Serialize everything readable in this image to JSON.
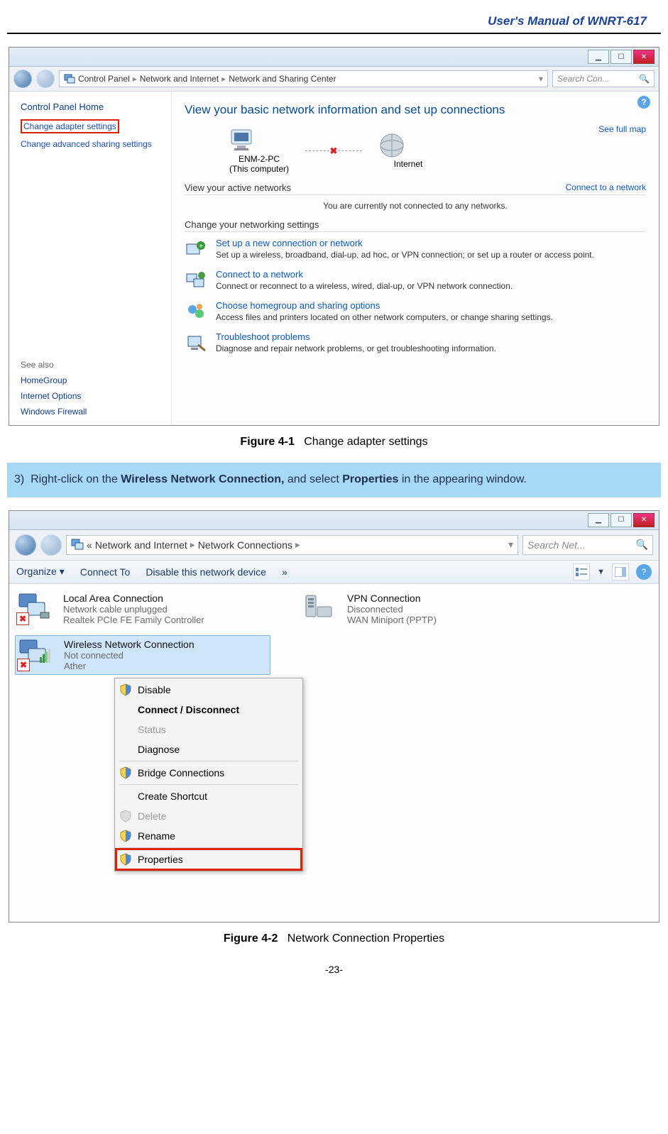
{
  "doc": {
    "header": "User's Manual of WNRT-617",
    "page_number": "-23-"
  },
  "fig1": {
    "label_bold": "Figure 4-1",
    "label_rest": "Change adapter settings"
  },
  "fig2": {
    "label_bold": "Figure 4-2",
    "label_rest": "Network Connection Properties"
  },
  "step": {
    "num": "3)",
    "t1": "Right-click on the ",
    "b1": "Wireless Network Connection,",
    "t2": " and select ",
    "b2": "Properties",
    "t3": " in the appearing window."
  },
  "s1": {
    "breadcrumb": [
      "Control Panel",
      "Network and Internet",
      "Network and Sharing Center"
    ],
    "search_placeholder": "Search Con...",
    "sidebar": {
      "head": "Control Panel Home",
      "items": [
        "Change adapter settings",
        "Change advanced sharing settings"
      ],
      "see_also_head": "See also",
      "see_also": [
        "HomeGroup",
        "Internet Options",
        "Windows Firewall"
      ]
    },
    "main": {
      "title": "View your basic network information and set up connections",
      "full_map": "See full map",
      "comp_name": "ENM-2-PC",
      "comp_sub": "(This computer)",
      "internet": "Internet",
      "active_label": "View your active networks",
      "connect_link": "Connect to a network",
      "not_connected": "You are currently not connected to any networks.",
      "change_label": "Change your networking settings",
      "actions": [
        {
          "lnk": "Set up a new connection or network",
          "desc": "Set up a wireless, broadband, dial-up, ad hoc, or VPN connection; or set up a router or access point."
        },
        {
          "lnk": "Connect to a network",
          "desc": "Connect or reconnect to a wireless, wired, dial-up, or VPN network connection."
        },
        {
          "lnk": "Choose homegroup and sharing options",
          "desc": "Access files and printers located on other network computers, or change sharing settings."
        },
        {
          "lnk": "Troubleshoot problems",
          "desc": "Diagnose and repair network problems, or get troubleshooting information."
        }
      ]
    }
  },
  "s2": {
    "breadcrumb_prefix": "«",
    "breadcrumb": [
      "Network and Internet",
      "Network Connections"
    ],
    "search_placeholder": "Search Net...",
    "toolbar": [
      "Organize ▾",
      "Connect To",
      "Disable this network device",
      "»"
    ],
    "conns": [
      {
        "name": "Local Area Connection",
        "state": "Network cable unplugged",
        "hw": "Realtek PCIe FE Family Controller"
      },
      {
        "name": "Wireless Network Connection",
        "state": "Not connected",
        "hw": "Ather"
      },
      {
        "name": "VPN Connection",
        "state": "Disconnected",
        "hw": "WAN Miniport (PPTP)"
      }
    ],
    "ctx": {
      "disable": "Disable",
      "connect": "Connect / Disconnect",
      "status": "Status",
      "diagnose": "Diagnose",
      "bridge": "Bridge Connections",
      "shortcut": "Create Shortcut",
      "delete": "Delete",
      "rename": "Rename",
      "properties": "Properties"
    }
  }
}
